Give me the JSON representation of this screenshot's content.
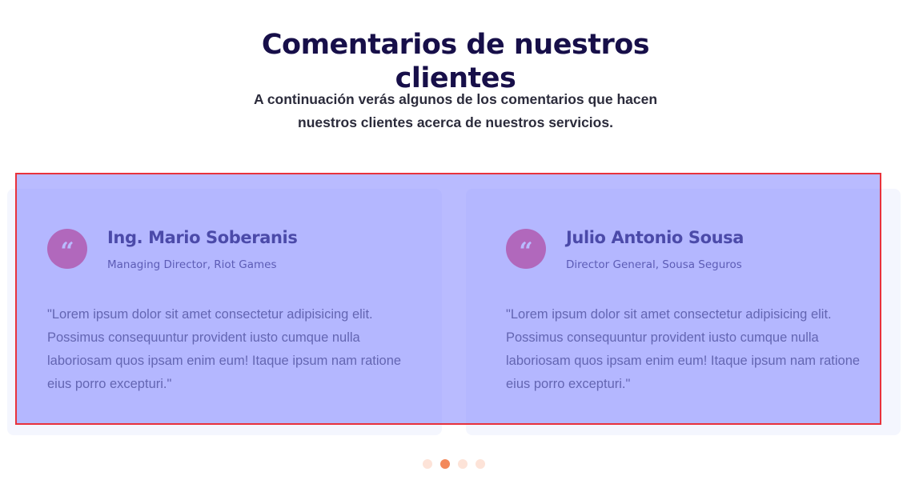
{
  "section": {
    "title_line1": "Comentarios de nuestros",
    "title_line2": "clientes",
    "subtitle_line1": "A continuación verás algunos de los comentarios que hacen",
    "subtitle_line2": "nuestros clientes acerca de nuestros servicios."
  },
  "testimonials": [
    {
      "quote_icon": "quote-icon",
      "quote_glyph": "“",
      "name": "Ing. Mario Soberanis",
      "role": "Managing Director, Riot Games",
      "text": "\"Lorem ipsum dolor sit amet consectetur adipisicing elit. Possimus consequuntur provident iusto cumque nulla laboriosam quos ipsam enim eum! Itaque ipsum nam ratione eius porro excepturi.\""
    },
    {
      "quote_icon": "quote-icon",
      "quote_glyph": "“",
      "name": "Julio Antonio Sousa",
      "role": "Director General, Sousa Seguros",
      "text": "\"Lorem ipsum dolor sit amet consectetur adipisicing elit. Possimus consequuntur provident iusto cumque nulla laboriosam quos ipsam enim eum! Itaque ipsum nam ratione eius porro excepturi.\""
    }
  ],
  "pagination": {
    "dot_count": 4,
    "active_index": 1
  },
  "colors": {
    "heading": "#170f49",
    "quote_badge": "#ee4f72",
    "card_background": "#f4f6fe",
    "dot_active": "#f3895b",
    "dot_inactive": "#fde3d8",
    "highlight_overlay": "#7a7eff",
    "highlight_border": "#e8323c"
  }
}
